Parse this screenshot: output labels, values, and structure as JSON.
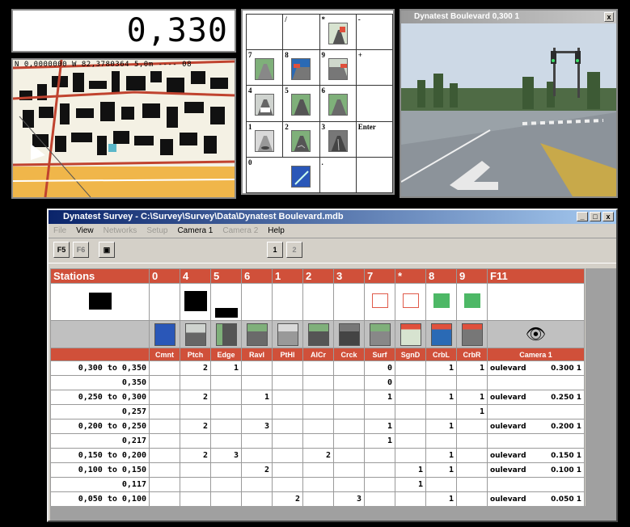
{
  "station_display": {
    "value": "0,330"
  },
  "map": {
    "coords": "N 0,0000000 W 82,3780364 5,0m  ----  08"
  },
  "keypad": {
    "keys": [
      "/",
      "*",
      "-",
      "7",
      "8",
      "9",
      "+",
      "4",
      "5",
      "6",
      "1",
      "2",
      "3",
      "Enter",
      "0",
      "."
    ]
  },
  "camera_window": {
    "title": "Dynatest Boulevard  0,300 1",
    "close": "x"
  },
  "survey_window": {
    "title": "Dynatest Survey - C:\\Survey\\Survey\\Data\\Dynatest Boulevard.mdb",
    "menu": [
      "File",
      "View",
      "Networks",
      "Setup",
      "Camera 1",
      "Camera 2",
      "Help"
    ],
    "toolbar": {
      "f5": "F5",
      "f6": "F6",
      "cam1": "1",
      "cam2": "2"
    },
    "win_buttons": [
      "_",
      "□",
      "x"
    ]
  },
  "table": {
    "header_keys": [
      "Stations",
      "0",
      "4",
      "5",
      "6",
      "1",
      "2",
      "3",
      "7",
      "*",
      "8",
      "9",
      "F11"
    ],
    "labels": [
      "Cmnt",
      "Ptch",
      "Edge",
      "Ravl",
      "PtHl",
      "AlCr",
      "Crck",
      "Surf",
      "SgnD",
      "CrbL",
      "CrbR",
      "Camera 1"
    ],
    "indicator_levels": {
      "Stations": 0.45,
      "Ptch": 0.55,
      "Edge": 0.25
    },
    "rows": [
      {
        "station": "0,300 to 0,350",
        "cells": [
          "",
          "2",
          "1",
          "",
          "",
          "",
          "",
          "0",
          "",
          "1",
          "1"
        ],
        "camera": "oulevard",
        "camera_val": "0.300 1"
      },
      {
        "station": "0,350",
        "cells": [
          "",
          "",
          "",
          "",
          "",
          "",
          "",
          "0",
          "",
          "",
          ""
        ],
        "camera": "",
        "camera_val": ""
      },
      {
        "station": "0,250 to 0,300",
        "cells": [
          "",
          "2",
          "",
          "1",
          "",
          "",
          "",
          "1",
          "",
          "1",
          "1"
        ],
        "camera": "oulevard",
        "camera_val": "0.250 1"
      },
      {
        "station": "0,257",
        "cells": [
          "",
          "",
          "",
          "",
          "",
          "",
          "",
          "",
          "",
          "",
          "1"
        ],
        "camera": "",
        "camera_val": ""
      },
      {
        "station": "0,200 to 0,250",
        "cells": [
          "",
          "2",
          "",
          "3",
          "",
          "",
          "",
          "1",
          "",
          "1",
          ""
        ],
        "camera": "oulevard",
        "camera_val": "0.200 1"
      },
      {
        "station": "0,217",
        "cells": [
          "",
          "",
          "",
          "",
          "",
          "",
          "",
          "1",
          "",
          "",
          ""
        ],
        "camera": "",
        "camera_val": ""
      },
      {
        "station": "0,150 to 0,200",
        "cells": [
          "",
          "2",
          "3",
          "",
          "",
          "2",
          "",
          "",
          "",
          "1",
          ""
        ],
        "camera": "oulevard",
        "camera_val": "0.150 1"
      },
      {
        "station": "0,100 to 0,150",
        "cells": [
          "",
          "",
          "",
          "2",
          "",
          "",
          "",
          "",
          "1",
          "1",
          ""
        ],
        "camera": "oulevard",
        "camera_val": "0.100 1"
      },
      {
        "station": "0,117",
        "cells": [
          "",
          "",
          "",
          "",
          "",
          "",
          "",
          "",
          "1",
          "",
          ""
        ],
        "camera": "",
        "camera_val": ""
      },
      {
        "station": "0,050 to 0,100",
        "cells": [
          "",
          "",
          "",
          "",
          "2",
          "",
          "3",
          "",
          "",
          "1",
          ""
        ],
        "camera": "oulevard",
        "camera_val": "0.050 1"
      }
    ]
  }
}
